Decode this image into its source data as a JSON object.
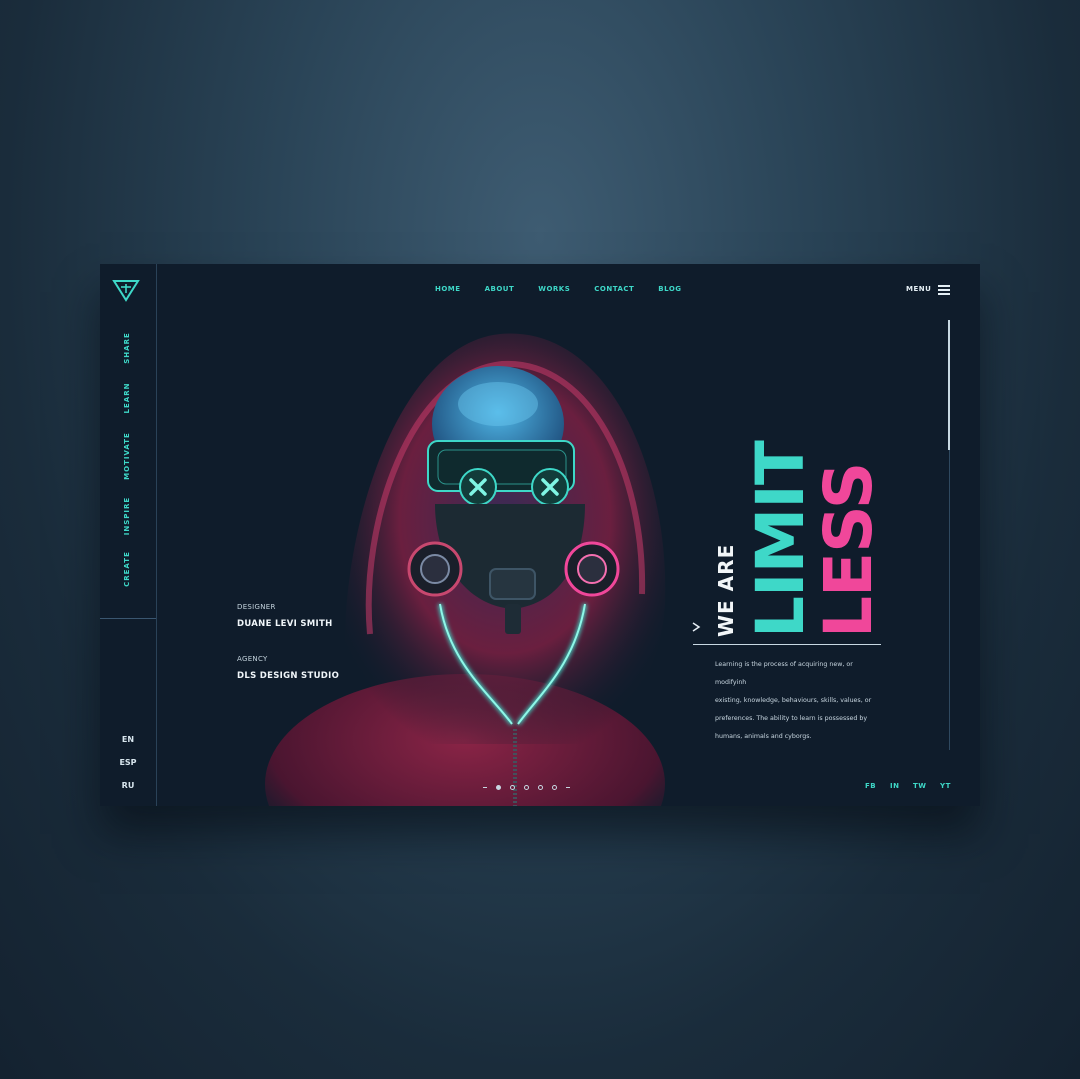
{
  "nav": {
    "items": [
      "HOME",
      "ABOUT",
      "WORKS",
      "CONTACT",
      "BLOG"
    ],
    "menu_label": "MENU"
  },
  "sidebar": {
    "items": [
      "SHARE",
      "LEARN",
      "MOTIVATE",
      "INSPIRE",
      "CREATE"
    ],
    "languages": [
      "EN",
      "ESP",
      "RU"
    ]
  },
  "info": {
    "designer_label": "DESIGNER",
    "designer_name": "DUANE LEVI SMITH",
    "agency_label": "AGENCY",
    "agency_name": "DLS DESIGN STUDIO"
  },
  "hero": {
    "we_are": "WE ARE",
    "limit": "LIMIT",
    "less": "LESS",
    "description_lines": [
      "Learning is the process of acquiring new, or modifyinh",
      "existing, knowledge, behaviours, skills, values, or",
      "preferences. The ability to learn is possessed by",
      "humans, animals and cyborgs."
    ]
  },
  "social": [
    "FB",
    "IN",
    "TW",
    "YT"
  ],
  "colors": {
    "accent_teal": "#3ed8c8",
    "accent_pink": "#f0479a",
    "card_bg": "#0f1c2b"
  }
}
